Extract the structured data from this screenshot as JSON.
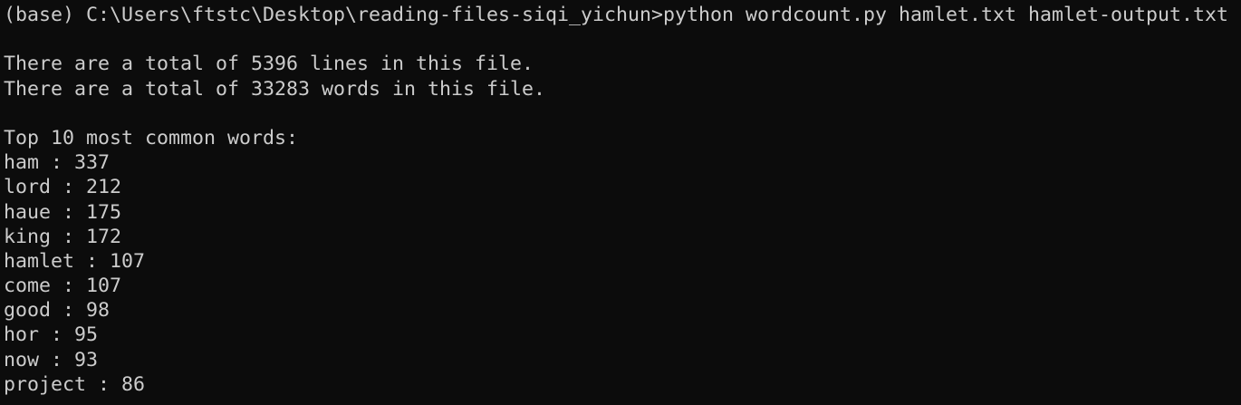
{
  "terminal": {
    "prompt": "(base) C:\\Users\\ftstc\\Desktop\\reading-files-siqi_yichun>",
    "command": "python wordcount.py hamlet.txt hamlet-output.txt",
    "summary": {
      "lines_text": "There are a total of 5396 lines in this file.",
      "words_text": "There are a total of 33283 words in this file."
    },
    "top_header": "Top 10 most common words:",
    "top_words": [
      "ham : 337",
      "lord : 212",
      "haue : 175",
      "king : 172",
      "hamlet : 107",
      "come : 107",
      "good : 98",
      "hor : 95",
      "now : 93",
      "project : 86"
    ],
    "colors": {
      "background": "#0c0c0c",
      "foreground": "#cccccc"
    }
  }
}
